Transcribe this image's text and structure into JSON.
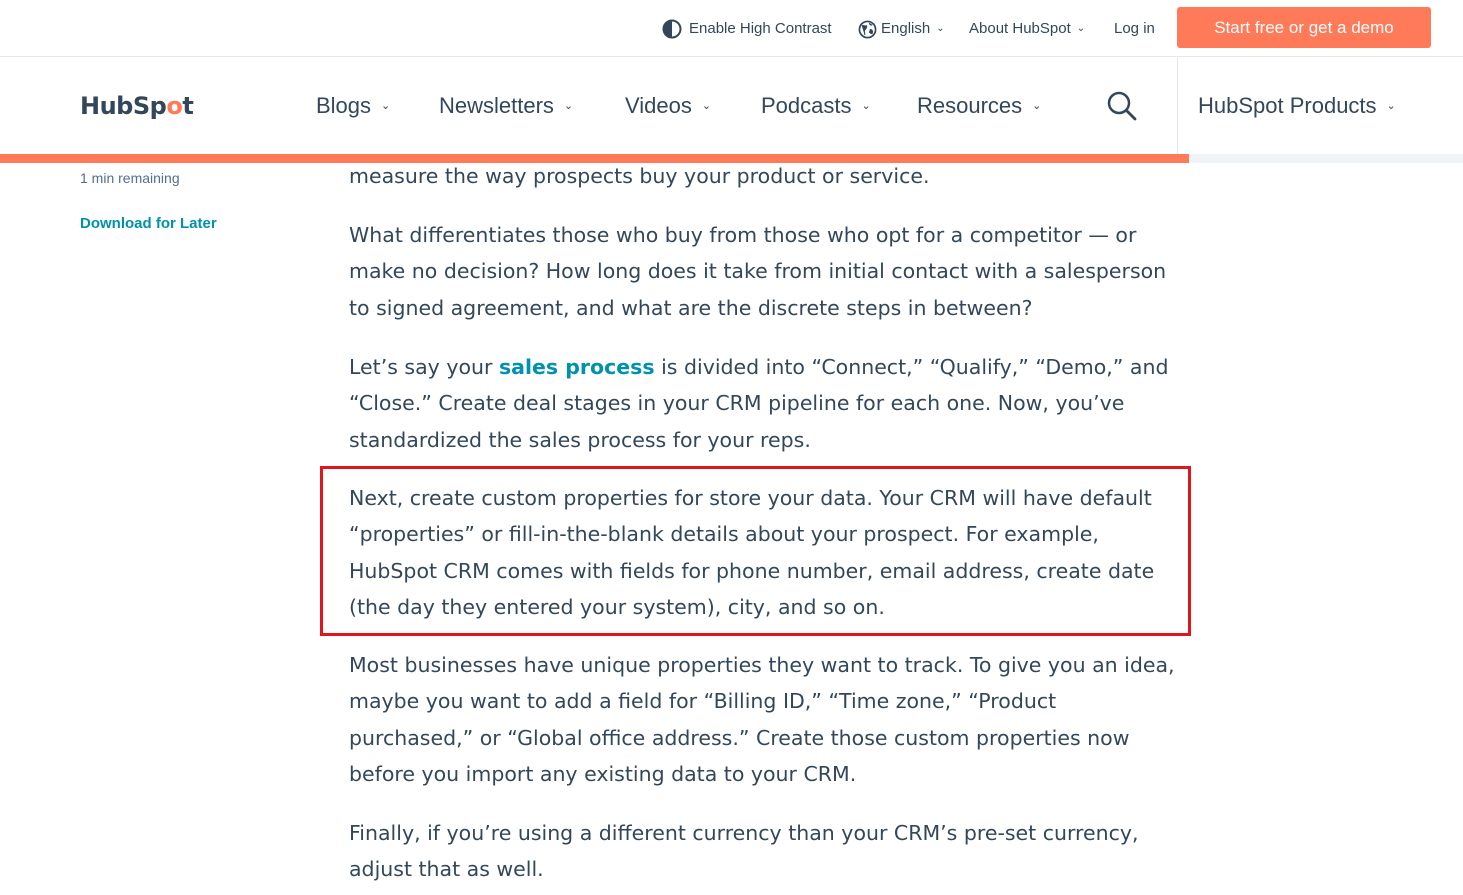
{
  "utility_bar": {
    "contrast_label": "Enable High Contrast",
    "language_label": "English",
    "about_label": "About HubSpot",
    "login_label": "Log in",
    "cta_label": "Start free or get a demo"
  },
  "nav": {
    "logo_text_pre": "HubSp",
    "logo_text_sprocket": "o",
    "logo_text_post": "t",
    "items": [
      {
        "label": "Blogs"
      },
      {
        "label": "Newsletters"
      },
      {
        "label": "Videos"
      },
      {
        "label": "Podcasts"
      },
      {
        "label": "Resources"
      }
    ],
    "products_label": "HubSpot Products"
  },
  "reading_progress": 0.813,
  "sidebar": {
    "time_remaining": "1 min remaining",
    "download_label": "Download for Later"
  },
  "article": {
    "p0": "measure the way prospects buy your product or service.",
    "p1": "What differentiates those who buy from those who opt for a competitor — or make no decision? How long does it take from initial contact with a salesperson to signed agreement, and what are the discrete steps in between?",
    "p2_before": "Let’s say your ",
    "p2_link": "sales process",
    "p2_after": " is divided into “Connect,” “Qualify,” “Demo,” and “Close.” Create deal stages in your CRM pipeline for each one. Now, you’ve standardized the sales process for your reps.",
    "p3": "Next, create custom properties for store your data. Your CRM will have default “properties” or fill-in-the-blank details about your prospect. For example, HubSpot CRM comes with fields for phone number, email address, create date (the day they entered your system), city, and so on.",
    "p4": "Most businesses have unique properties they want to track. To give you an idea, maybe you want to add a field for “Billing ID,” “Time zone,” “Product purchased,” or “Global office address.” Create those custom properties now before you import any existing data to your CRM.",
    "p5": "Finally, if you’re using a different currency than your CRM’s pre-set currency, adjust that as well."
  },
  "colors": {
    "accent": "#ff7a59",
    "link": "#0091ae",
    "text": "#33475b",
    "highlight_border": "#e0161e"
  }
}
